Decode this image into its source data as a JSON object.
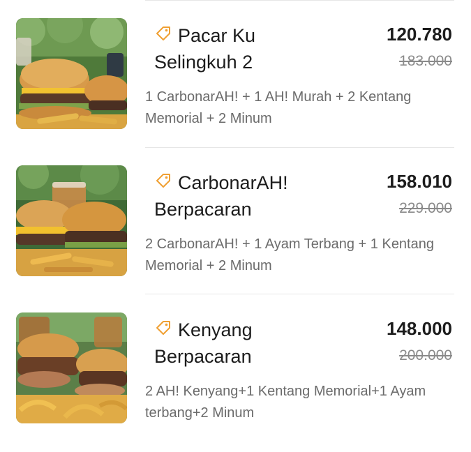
{
  "colors": {
    "promo_icon": "#F0A033",
    "text_primary": "#1C1C1C",
    "text_secondary": "#6B6B6B",
    "divider": "#E6E6E6"
  },
  "menu": {
    "items": [
      {
        "name_line1": "Pacar Ku",
        "name_line2": "Selingkuh 2",
        "price_final": "120.780",
        "price_original": "183.000",
        "description": "1 CarbonarAH! + 1 AH! Murah + 2 Kentang Memorial + 2 Minum",
        "icon": "promo-tag-icon"
      },
      {
        "name_line1": "CarbonarAH!",
        "name_line2": "Berpacaran",
        "price_final": "158.010",
        "price_original": "229.000",
        "description": "2 CarbonarAH! + 1 Ayam Terbang + 1 Kentang Memorial + 2 Minum",
        "icon": "promo-tag-icon"
      },
      {
        "name_line1": "Kenyang",
        "name_line2": "Berpacaran",
        "price_final": "148.000",
        "price_original": "200.000",
        "description": "2 AH! Kenyang+1 Kentang Memorial+1 Ayam terbang+2 Minum",
        "icon": "promo-tag-icon"
      }
    ]
  }
}
